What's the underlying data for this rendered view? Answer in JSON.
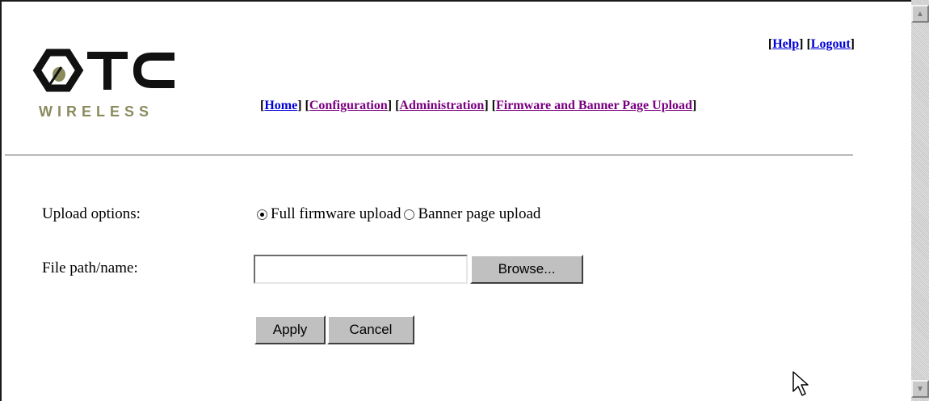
{
  "logo": {
    "wordmark": "OTC",
    "subtitle": "WIRELESS",
    "accent_color": "#8b8b5e"
  },
  "top_links": [
    {
      "label": "Help"
    },
    {
      "label": "Logout"
    }
  ],
  "nav_links": [
    {
      "label": "Home"
    },
    {
      "label": "Configuration"
    },
    {
      "label": "Administration"
    },
    {
      "label": "Firmware and Banner Page Upload"
    }
  ],
  "form": {
    "upload_options_label": "Upload options:",
    "options": [
      {
        "label": "Full firmware upload",
        "checked": true
      },
      {
        "label": "Banner page upload",
        "checked": false
      }
    ],
    "file_label": "File path/name:",
    "file_value": "",
    "browse_label": "Browse...",
    "apply_label": "Apply",
    "cancel_label": "Cancel"
  },
  "colors": {
    "link": "#0000d8",
    "visited_link": "#7a0080",
    "button_face": "#c0c0c0"
  }
}
